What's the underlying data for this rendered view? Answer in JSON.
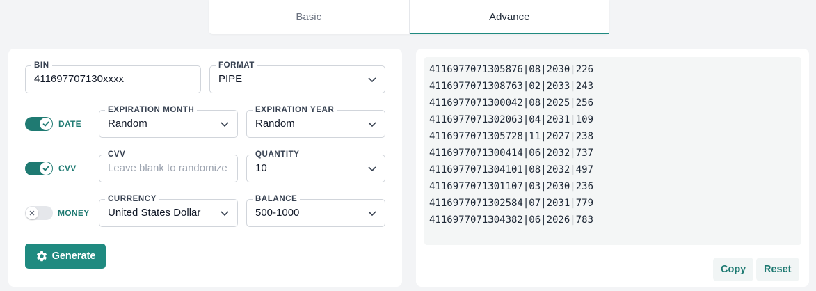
{
  "tabs": [
    {
      "label": "Basic",
      "active": false
    },
    {
      "label": "Advance",
      "active": true
    }
  ],
  "form": {
    "bin": {
      "label": "BIN",
      "value": "411697707130xxxx"
    },
    "format": {
      "label": "FORMAT",
      "value": "PIPE"
    },
    "date_toggle": {
      "label": "DATE",
      "on": true
    },
    "exp_month": {
      "label": "EXPIRATION MONTH",
      "value": "Random"
    },
    "exp_year": {
      "label": "EXPIRATION YEAR",
      "value": "Random"
    },
    "cvv_toggle": {
      "label": "CVV",
      "on": true
    },
    "cvv": {
      "label": "CVV",
      "placeholder": "Leave blank to randomize"
    },
    "quantity": {
      "label": "QUANTITY",
      "value": "10"
    },
    "money_toggle": {
      "label": "MONEY",
      "on": false
    },
    "currency": {
      "label": "CURRENCY",
      "value": "United States Dollar"
    },
    "balance": {
      "label": "BALANCE",
      "value": "500-1000"
    },
    "generate_label": "Generate"
  },
  "output": {
    "lines": [
      "4116977071305876|08|2030|226",
      "4116977071308763|02|2033|243",
      "4116977071300042|08|2025|256",
      "4116977071302063|04|2031|109",
      "4116977071305728|11|2027|238",
      "4116977071300414|06|2032|737",
      "4116977071304101|08|2032|497",
      "4116977071301107|03|2030|236",
      "4116977071302584|07|2031|779",
      "4116977071304382|06|2026|783"
    ],
    "copy_label": "Copy",
    "reset_label": "Reset"
  },
  "colors": {
    "accent": "#1f8a80",
    "toggle_on": "#1f7a72",
    "background": "#f3f4f6"
  },
  "icons": {
    "generate": "gear-icon",
    "select": "chevron-down-icon",
    "toggle_on": "check-icon",
    "toggle_off": "x-icon"
  }
}
